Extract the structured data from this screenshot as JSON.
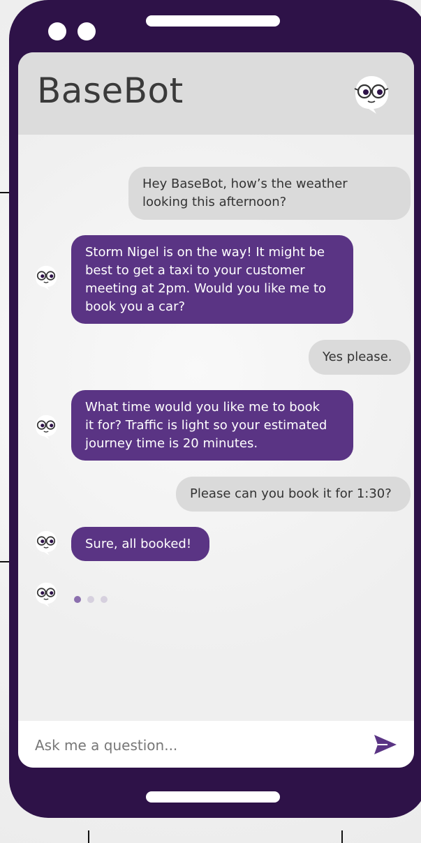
{
  "app": {
    "title": "BaseBot"
  },
  "conversation": [
    {
      "sender": "user",
      "text": "Hey BaseBot, how’s the weather\nlooking this afternoon?"
    },
    {
      "sender": "bot",
      "text": "Storm Nigel is on the way! It might be\nbest to get a taxi to your customer\nmeeting at 2pm. Would you like me to\nbook you a car?"
    },
    {
      "sender": "user",
      "text": "Yes please."
    },
    {
      "sender": "bot",
      "text": "What time would you like me to book\nit for? Traffic is light so your estimated\njourney time is 20 minutes."
    },
    {
      "sender": "user",
      "text": "Please can you book it for 1:30?"
    },
    {
      "sender": "bot",
      "text": "Sure, all booked!"
    }
  ],
  "composer": {
    "placeholder": "Ask me a question..."
  },
  "icons": {
    "header_avatar": "bot-glasses-avatar-icon",
    "bot_avatar": "bot-glasses-avatar-icon",
    "send": "send-arrow-icon"
  },
  "colors": {
    "phone_frame": "#2e1248",
    "bot_bubble": "#5a3484",
    "user_bubble": "#dadada",
    "header_bg": "#dcdcdc",
    "send_icon": "#5a3484",
    "typing_dot_active": "#8b6fae",
    "typing_dot_idle": "#d6d0de"
  }
}
